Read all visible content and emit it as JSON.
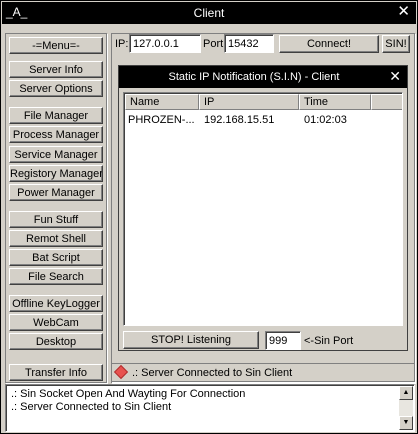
{
  "window": {
    "app_icon": "_A_",
    "title": "Client",
    "close_icon": "close-icon"
  },
  "menu": {
    "header": "-=Menu=-",
    "items": [
      "Server Info",
      "Server Options",
      "File Manager",
      "Process Manager",
      "Service Manager",
      "Registory Manager",
      "Power Manager",
      "Fun Stuff",
      "Remot Shell",
      "Bat Script",
      "File Search",
      "Offline KeyLogger",
      "WebCam",
      "Desktop"
    ],
    "transfer": "Transfer Info"
  },
  "connection": {
    "ip_label": "IP:",
    "ip_value": "127.0.0.1",
    "port_label": "Port",
    "port_value": "15432",
    "connect_button": "Connect!",
    "sin_button": "SIN!"
  },
  "sin_window": {
    "title": "Static IP Notification (S.I.N) - Client",
    "columns": [
      "Name",
      "IP",
      "Time"
    ],
    "rows": [
      {
        "name": "PHROZEN-...",
        "ip": "192.168.15.51",
        "time": "01:02:03"
      }
    ],
    "stop_button": "STOP! Listening",
    "port_value": "999",
    "port_label": "<-Sin Port"
  },
  "status": {
    "text": ".: Server Connected to Sin Client",
    "icon": "red-diamond-icon"
  },
  "log": {
    "lines": [
      ".: Sin Socket Open And Wayting For Connection",
      ".: Server Connected to Sin Client"
    ]
  },
  "colors": {
    "titlebar": "#000000",
    "face": "#d4d0c8",
    "status_icon": "#e8524f"
  }
}
